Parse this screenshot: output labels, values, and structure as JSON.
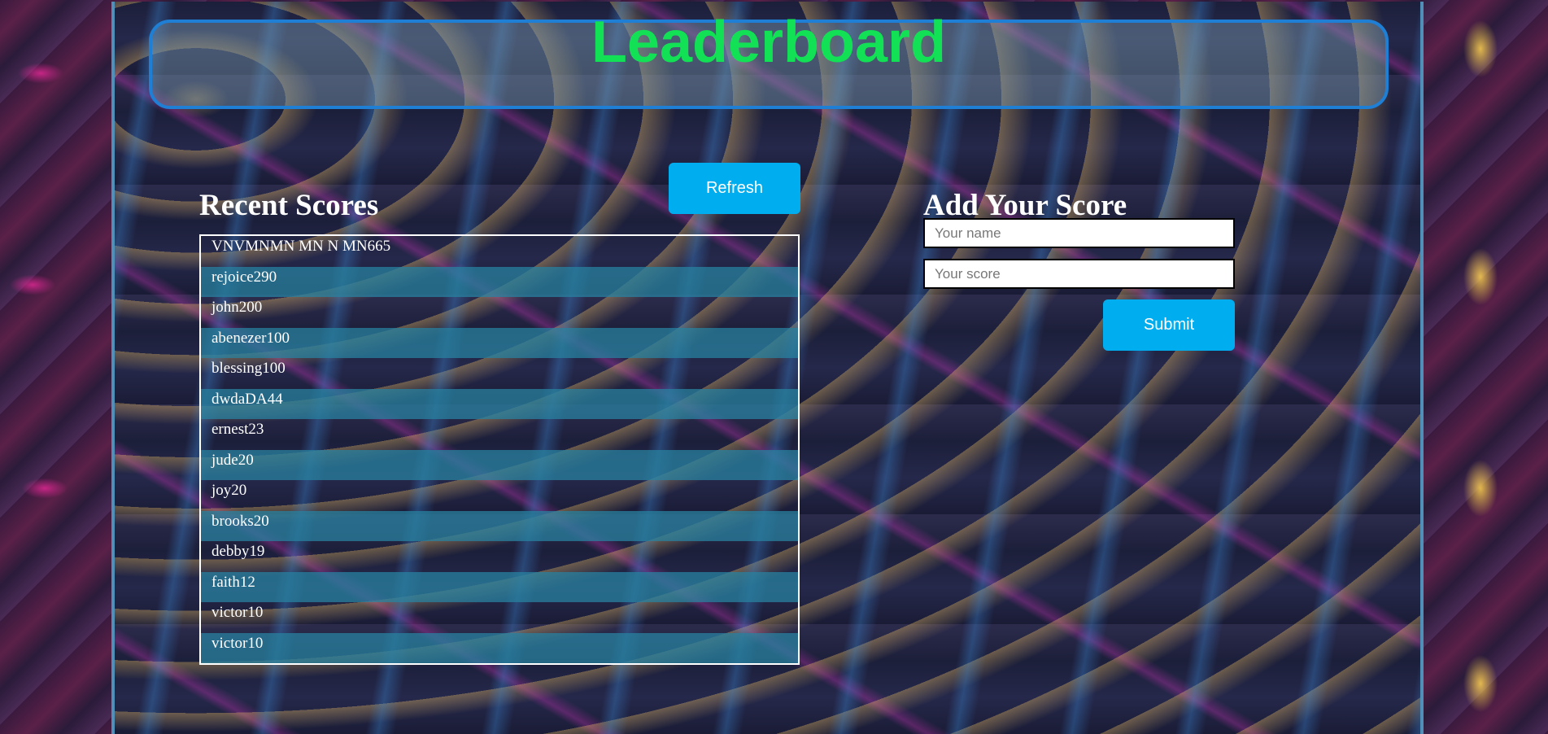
{
  "header": {
    "title": "Leaderboard"
  },
  "recent": {
    "title": "Recent Scores",
    "refresh_label": "Refresh",
    "scores": [
      "VNVMNMN MN N MN665",
      "rejoice290",
      "john200",
      "abenezer100",
      "blessing100",
      "dwdaDA44",
      "ernest23",
      "jude20",
      "joy20",
      "brooks20",
      "debby19",
      "faith12",
      "victor10",
      "victor10"
    ]
  },
  "add": {
    "title": "Add Your Score",
    "name_placeholder": "Your name",
    "score_placeholder": "Your score",
    "submit_label": "Submit"
  },
  "colors": {
    "title_green": "#12e055",
    "button_blue": "#00aeef",
    "header_border": "#1f7fd4",
    "row_alt": "#2882a0"
  }
}
